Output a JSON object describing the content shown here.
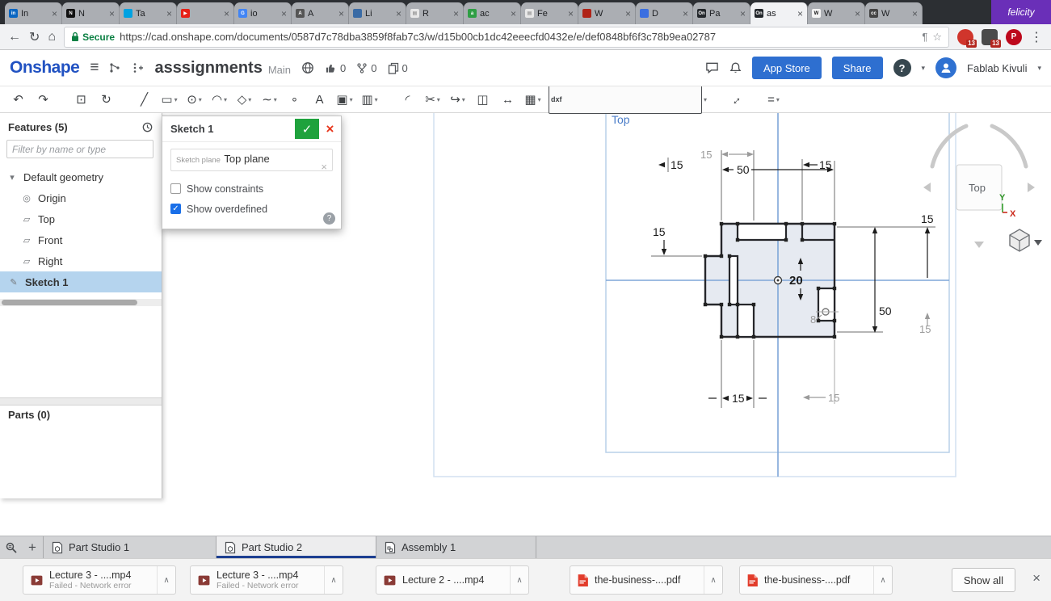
{
  "glyphs": {
    "close": "×",
    "caret": "▾",
    "chevron_up": "∧",
    "check": "✓",
    "plus": "+",
    "menu_dots": "⋮",
    "star": "☆",
    "back": "←",
    "reload": "↻",
    "home": "⌂",
    "hamburger": "≡",
    "page_action": "¶"
  },
  "browser": {
    "profile_name": "felicity",
    "tabs": [
      {
        "label": "In",
        "fav": "#0a66c2",
        "ch": "in"
      },
      {
        "label": "N",
        "fav": "#111111",
        "ch": "N"
      },
      {
        "label": "Ta",
        "fav": "#00a2e2",
        "ch": ""
      },
      {
        "label": "",
        "fav": "#e62117",
        "ch": "▶"
      },
      {
        "label": "io",
        "fav": "#4285f4",
        "ch": "G"
      },
      {
        "label": "A",
        "fav": "#555555",
        "ch": "A"
      },
      {
        "label": "Li",
        "fav": "#3a6ba5",
        "ch": ""
      },
      {
        "label": "R",
        "fav": "#e8e8e8",
        "ch": "▤",
        "fg": "#777777"
      },
      {
        "label": "ac",
        "fav": "#2f9e44",
        "ch": "a"
      },
      {
        "label": "Fe",
        "fav": "#e8e8e8",
        "ch": "▤",
        "fg": "#777777"
      },
      {
        "label": "W",
        "fav": "#b02418",
        "ch": ""
      },
      {
        "label": "D",
        "fav": "#3b6fe0",
        "ch": ""
      },
      {
        "label": "Pa",
        "fav": "#23272b",
        "ch": "On"
      },
      {
        "label": "as",
        "fav": "#23272b",
        "ch": "On",
        "active": true
      },
      {
        "label": "W",
        "fav": "#f5f5f5",
        "ch": "W",
        "fg": "#111111"
      },
      {
        "label": "W",
        "fav": "#444444",
        "ch": "cc"
      }
    ]
  },
  "address": {
    "secure": "Secure",
    "url": "https://cad.onshape.com/documents/0587d7c78dba3859f8fab7c3/w/d15b00cb1dc42eeecfd0432e/e/def0848bf6f3c78b9ea02787",
    "ext_badge_1": "13",
    "ext_badge_2": "13",
    "pinterest": "P"
  },
  "header": {
    "logo": "Onshape",
    "title": "asssignments",
    "workspace": "Main",
    "likes": "0",
    "forks": "0",
    "copies": "0",
    "app_store": "App Store",
    "share": "Share",
    "help": "?",
    "user": "Fablab Kivuli"
  },
  "toolbar": {
    "items": [
      {
        "name": "undo-icon",
        "g": "↶"
      },
      {
        "name": "redo-icon",
        "g": "↷"
      },
      {
        "name": "copy-sketch-icon",
        "g": "⊡",
        "gap": true
      },
      {
        "name": "derive-icon",
        "g": "↻"
      },
      {
        "name": "line-icon",
        "g": "╱",
        "gap": true
      },
      {
        "name": "rectangle-icon",
        "g": "▭",
        "dd": true
      },
      {
        "name": "circle-icon",
        "g": "⊙",
        "dd": true
      },
      {
        "name": "arc-icon",
        "g": "◠",
        "dd": true
      },
      {
        "name": "polygon-icon",
        "g": "◇",
        "dd": true
      },
      {
        "name": "spline-icon",
        "g": "∼",
        "dd": true
      },
      {
        "name": "point-icon",
        "g": "∘"
      },
      {
        "name": "text-icon",
        "g": "A"
      },
      {
        "name": "use-convert-icon",
        "g": "▣",
        "dd": true
      },
      {
        "name": "pattern-icon",
        "g": "▥",
        "dd": true
      },
      {
        "name": "fillet-icon",
        "g": "◜",
        "gap": true
      },
      {
        "name": "trim-icon",
        "g": "✂",
        "dd": true
      },
      {
        "name": "extend-icon",
        "g": "↪",
        "dd": true
      },
      {
        "name": "mirror-icon",
        "g": "◫"
      },
      {
        "name": "dimension-icon",
        "g": "↔"
      },
      {
        "name": "grid-pattern-icon",
        "g": "▦",
        "dd": true
      },
      {
        "name": "insert-dxf-icon",
        "g": "dxf",
        "chip": true,
        "dd": true
      },
      {
        "name": "measure-icon",
        "g": "↔",
        "rot": true,
        "gap": true
      },
      {
        "name": "display-options-icon",
        "g": "=",
        "dd": true,
        "gap": true
      }
    ]
  },
  "features_panel": {
    "title": "Features (5)",
    "filter_placeholder": "Filter by name or type",
    "tree": [
      {
        "label": "Default geometry",
        "icon": "▾"
      },
      {
        "label": "Origin",
        "icon": "◎"
      },
      {
        "label": "Top",
        "icon": "▱"
      },
      {
        "label": "Front",
        "icon": "▱"
      },
      {
        "label": "Right",
        "icon": "▱"
      },
      {
        "label": "Sketch 1",
        "icon": "✎",
        "selected": true
      }
    ],
    "parts_title": "Parts (0)"
  },
  "sketch_dialog": {
    "title": "Sketch 1",
    "plane_label": "Sketch plane",
    "plane_value": "Top plane",
    "show_constraints": "Show constraints",
    "show_overdefined": "Show overdefined",
    "help": "?"
  },
  "canvas": {
    "plane_label": "Top",
    "dims": {
      "offset_top": "15",
      "width_top": "50",
      "step_top": "15",
      "tab_top": "15",
      "left_height": "15",
      "right_top": "15",
      "center_height": "20",
      "right_height": "50",
      "right_bottom": "15",
      "hole": "8",
      "bottom_width": "15",
      "bottom_right": "15"
    },
    "viewcube": {
      "face": "Top",
      "axis_x": "X",
      "axis_y": "Y"
    }
  },
  "bottom_tabs": {
    "tabs": [
      {
        "label": "Part Studio 1"
      },
      {
        "label": "Part Studio 2",
        "active": true
      },
      {
        "label": "Assembly 1"
      }
    ]
  },
  "downloads": {
    "items": [
      {
        "name": "Lecture 3 - ....mp4",
        "status": "Failed - Network error",
        "is_mp4": true,
        "ml": "0px"
      },
      {
        "name": "Lecture 3 - ....mp4",
        "status": "Failed - Network error",
        "is_mp4": true,
        "ml": "17px"
      },
      {
        "name": "Lecture 2 - ....mp4",
        "status": "",
        "is_mp4": true,
        "ml": "40px"
      },
      {
        "name": "the-business-....pdf",
        "status": "",
        "is_pdf": true,
        "ml": "50px"
      },
      {
        "name": "the-business-....pdf",
        "status": "",
        "is_pdf": true,
        "ml": "20px"
      }
    ],
    "show_all": "Show all"
  }
}
